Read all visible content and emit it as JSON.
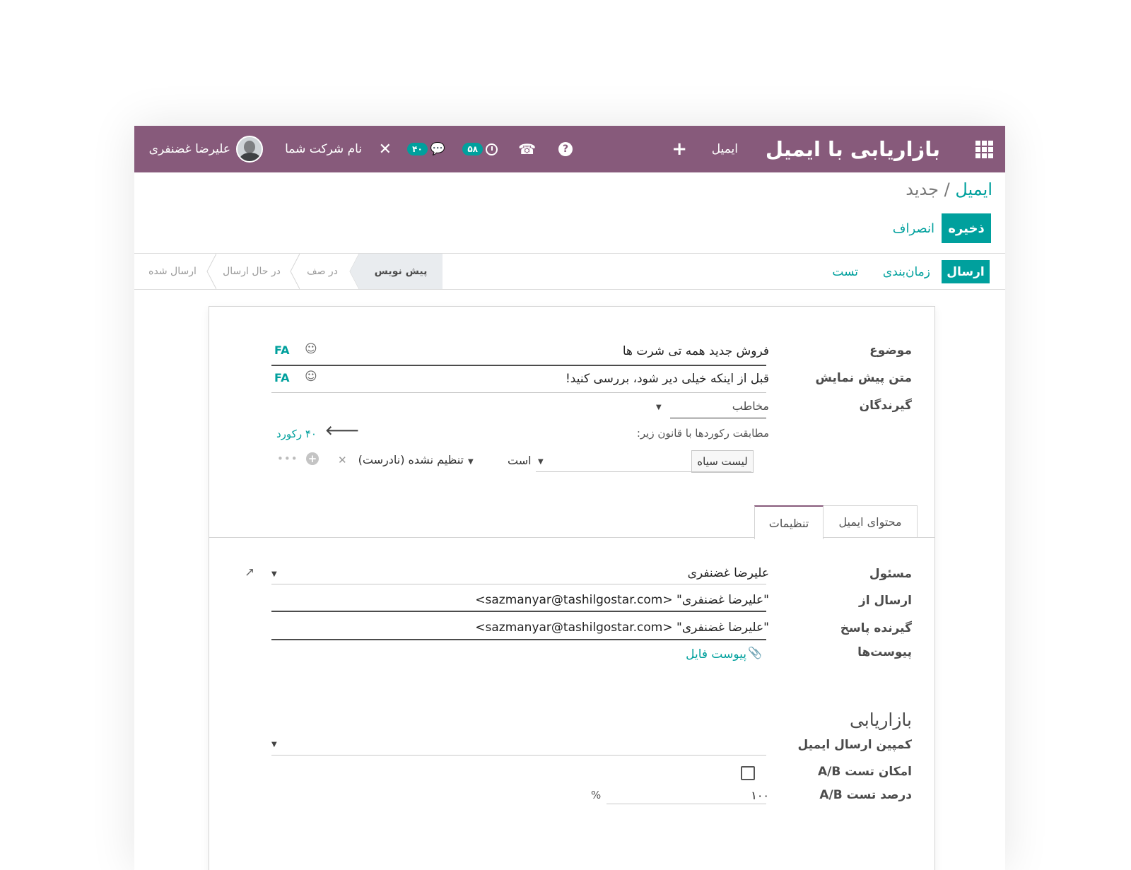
{
  "navbar": {
    "apps_icon": "apps-grid-icon",
    "app_title": "بازاریابی با ایمیل",
    "menu_email": "ایمیل",
    "plus": "+",
    "help": "?",
    "phone": "☎",
    "activity_count": "۵۸",
    "chat_count": "۴۰",
    "tools": "✕",
    "company": "نام شرکت شما",
    "user_name": "علیرضا غضنفری"
  },
  "breadcrumb": {
    "parent": "ایمیل",
    "separator": "/",
    "current": "جدید"
  },
  "buttons": {
    "save": "ذخیره",
    "discard": "انصراف"
  },
  "statusbar": {
    "send": "ارسال",
    "schedule": "زمان‌بندی",
    "test": "تست",
    "stages": [
      "پیش نویس",
      "در صف",
      "در حال ارسال",
      "ارسال شده"
    ],
    "active_stage": "پیش نویس"
  },
  "form": {
    "subject": {
      "label": "موضوع",
      "value": "فروش جدید همه تی شرت ها",
      "lang": "FA"
    },
    "preview": {
      "label": "متن پیش نمایش",
      "value": "قبل از اینکه خیلی دیر شود، بررسی کنید!",
      "lang": "FA"
    },
    "recipients": {
      "label": "گیرندگان",
      "value": "مخاطب",
      "match_text": "مطابقت رکوردها با قانون زیر:",
      "record_count": "۴۰ رکورد",
      "rule_field": "لیست سیاه",
      "rule_operator": "است",
      "rule_value": "تنظیم نشده (نادرست)"
    },
    "tabs": [
      "محتوای ایمیل",
      "تنظیمات"
    ],
    "active_tab": "تنظیمات",
    "responsible": {
      "label": "مسئول",
      "value": "علیرضا غضنفری"
    },
    "send_from": {
      "label": "ارسال از",
      "value": "\"علیرضا غضنفری\" <sazmanyar@tashilgostar.com>"
    },
    "reply_to": {
      "label": "گیرنده پاسخ",
      "value": "\"علیرضا غضنفری\" <sazmanyar@tashilgostar.com>"
    },
    "attachments": {
      "label": "پیوست‌ها",
      "link": "پیوست فایل"
    },
    "marketing": {
      "title": "بازاریابی",
      "campaign_label": "کمپین ارسال ایمیل",
      "campaign_value": "",
      "ab_label": "امکان تست A/B",
      "ab_checked": false,
      "ab_pct_label": "درصد تست A/B",
      "ab_pct_value": "۱۰۰",
      "ab_pct_unit": "%"
    }
  },
  "colors": {
    "navbar": "#875a7b",
    "accent": "#00a09d"
  }
}
